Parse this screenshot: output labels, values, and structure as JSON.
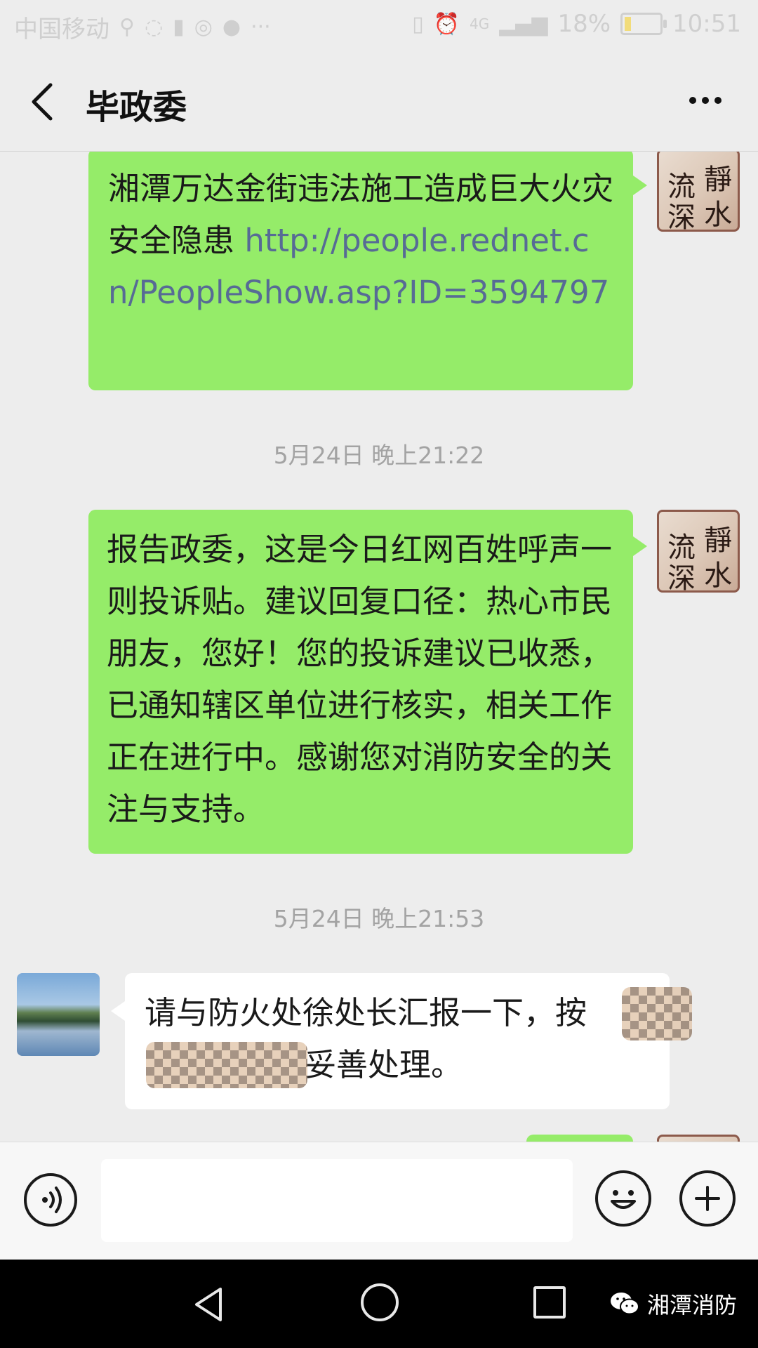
{
  "status_bar": {
    "carrier": "中国移动",
    "network": "4G",
    "battery": "18%",
    "time": "10:51"
  },
  "header": {
    "title": "毕政委",
    "back_icon": "chevron-left-icon",
    "more_icon": "more-dots-icon"
  },
  "messages": [
    {
      "direction": "out",
      "text": "湘潭万达金街违法施工造成巨大火灾安全隐患 ",
      "link": "http://people.rednet.cn/PeopleShow.asp?ID=3594797"
    },
    {
      "timestamp": "5月24日 晚上21:22"
    },
    {
      "direction": "out",
      "text": "报告政委，这是今日红网百姓呼声一则投诉贴。建议回复口径：热心市民朋友，您好！您的投诉建议已收悉，已通知辖区单位进行核实，相关工作正在进行中。感谢您对消防安全的关注与支持。"
    },
    {
      "timestamp": "5月24日 晚上21:53"
    },
    {
      "direction": "in",
      "text_line1": "请与防火处徐处长汇报一下，按",
      "text_line2_tail": "妥善处理。"
    }
  ],
  "input": {
    "value": "",
    "voice_icon": "voice-icon",
    "emoji_icon": "emoji-icon",
    "plus_icon": "plus-icon"
  },
  "watermark": {
    "label": "湘潭消防"
  },
  "colors": {
    "outgoing_bubble": "#95ec69",
    "incoming_bubble": "#ffffff",
    "link": "#576b95",
    "background": "#ededed"
  }
}
